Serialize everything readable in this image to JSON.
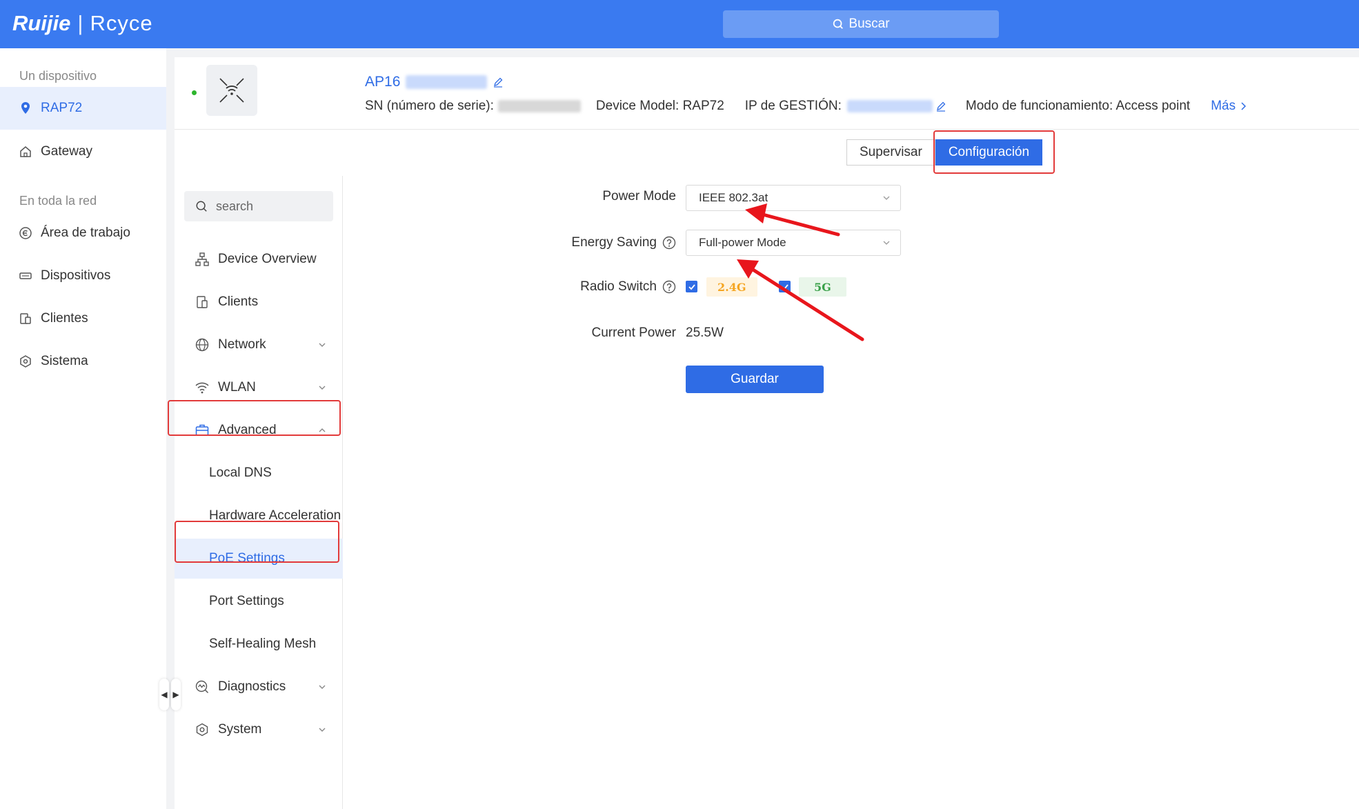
{
  "brand": {
    "logo_left": "Ruijie",
    "logo_sep": "|",
    "logo_right": "Rcyce"
  },
  "topbar": {
    "search_label": "Buscar"
  },
  "leftnav": {
    "section_device": "Un dispositivo",
    "device_item": "RAP72",
    "gateway_item": "Gateway",
    "section_network": "En toda la red",
    "workspace_item": "Área de trabajo",
    "devices_item": "Dispositivos",
    "clients_item": "Clientes",
    "system_item": "Sistema"
  },
  "device": {
    "name": "AP16",
    "sn_label": "SN (número de serie):",
    "model_label": "Device Model: RAP72",
    "ip_label": "IP de GESTIÓN:",
    "mode_label": "Modo de funcionamiento: Access point",
    "more_label": "Más"
  },
  "mode_tabs": {
    "monitor": "Supervisar",
    "config": "Configuración"
  },
  "subnav": {
    "search_placeholder": "search",
    "device_overview": "Device Overview",
    "clients": "Clients",
    "network": "Network",
    "wlan": "WLAN",
    "advanced": "Advanced",
    "local_dns": "Local DNS",
    "hw_accel": "Hardware Acceleration",
    "poe_settings": "PoE Settings",
    "port_settings": "Port Settings",
    "self_healing": "Self-Healing Mesh",
    "diagnostics": "Diagnostics",
    "system": "System"
  },
  "form": {
    "power_mode_label": "Power Mode",
    "power_mode_value": "IEEE 802.3at",
    "energy_saving_label": "Energy Saving",
    "energy_saving_value": "Full-power Mode",
    "radio_switch_label": "Radio Switch",
    "radio_24": "2.4G",
    "radio_5": "5G",
    "radio_24_checked": true,
    "radio_5_checked": true,
    "current_power_label": "Current Power",
    "current_power_value": "25.5W",
    "save_label": "Guardar"
  },
  "colors": {
    "primary": "#2f6ce5",
    "topbar": "#3a7af0",
    "annotation": "#e23a3a"
  }
}
